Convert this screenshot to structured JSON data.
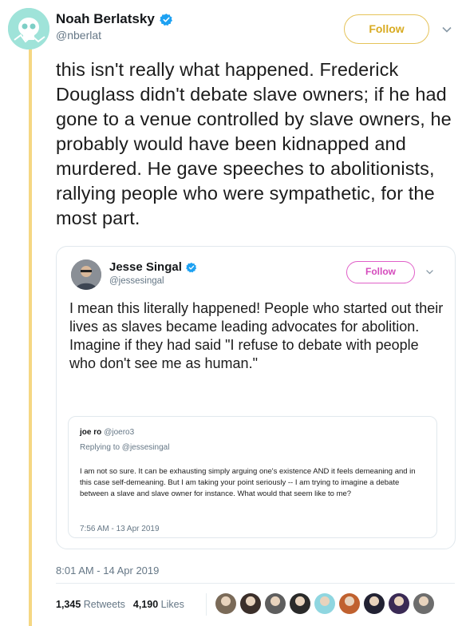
{
  "tweet": {
    "author_name": "Noah Berlatsky",
    "author_handle": "@nberlat",
    "follow_label": "Follow",
    "text": "this isn't really what happened. Frederick Douglass didn't debate slave owners; if he had gone to a venue controlled by slave owners, he probably would have been kidnapped and murdered. He gave speeches to abolitionists, rallying people who were sympathetic, for the most part.",
    "timestamp": "8:01 AM - 14 Apr 2019",
    "retweets_count": "1,345",
    "retweets_label": "Retweets",
    "likes_count": "4,190",
    "likes_label": "Likes",
    "accent_color": "#d8ab22"
  },
  "quoted_tweet": {
    "author_name": "Jesse Singal",
    "author_handle": "@jessesingal",
    "follow_label": "Follow",
    "text": "I mean this literally happened! People who started out their lives as slaves became leading advocates for abolition. Imagine if they had said \"I refuse to debate with people who don't see me as human.\"",
    "accent_color": "#d54bbd"
  },
  "nested_quote": {
    "author_name": "joe ro",
    "author_handle": "@joero3",
    "reply_to": "Replying to @jessesingal",
    "text": "I am not so sure. It can be exhausting simply arguing one's existence AND it feels demeaning and in this case self-demeaning. But I am taking your point seriously -- I am trying to imagine a debate between a slave and slave owner for instance. What would that seem like to me?",
    "timestamp": "7:56 AM - 13 Apr 2019"
  },
  "likers": [
    {
      "icon": "avatar-icon",
      "color": "#7a6a58"
    },
    {
      "icon": "avatar-icon",
      "color": "#3b2f2a"
    },
    {
      "icon": "avatar-icon",
      "color": "#5e5e5e"
    },
    {
      "icon": "avatar-icon",
      "color": "#2a2a2a"
    },
    {
      "icon": "avatar-icon",
      "color": "#8fd6e0"
    },
    {
      "icon": "avatar-icon",
      "color": "#c0612f"
    },
    {
      "icon": "avatar-icon",
      "color": "#222233"
    },
    {
      "icon": "avatar-icon",
      "color": "#3a2a55"
    },
    {
      "icon": "avatar-icon",
      "color": "#6d6d6d"
    }
  ]
}
